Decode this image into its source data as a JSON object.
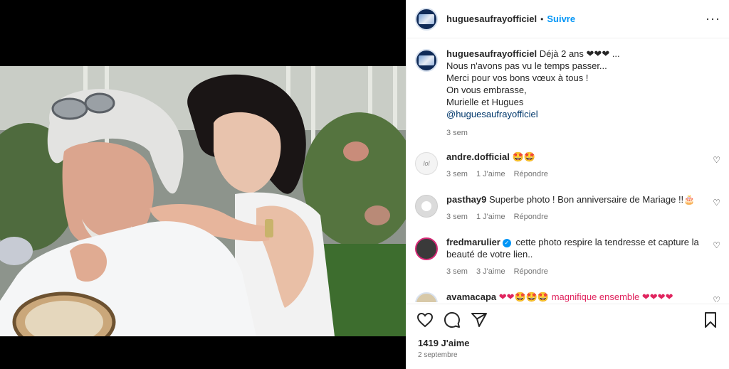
{
  "post": {
    "username": "huguesaufrayofficiel",
    "follow_label": "Suivre",
    "more_label": "···"
  },
  "caption": {
    "username": "huguesaufrayofficiel",
    "line1": "Déjà 2 ans ❤❤❤ ...",
    "line2": "Nous n'avons pas vu le temps passer...",
    "line3": "Merci pour vos bons vœux à tous !",
    "line4": "On vous embrasse,",
    "line5": "Murielle et Hugues",
    "mention": "@huguesaufrayofficiel",
    "time": "3 sem"
  },
  "comments": [
    {
      "username": "andre.dofficial",
      "text": "🤩🤩",
      "time": "3 sem",
      "likes": "1 J'aime",
      "reply": "Répondre",
      "avatar_text": "lol"
    },
    {
      "username": "pasthay9",
      "text": "Superbe photo ! Bon anniversaire de Mariage !!🎂",
      "time": "3 sem",
      "likes": "1 J'aime",
      "reply": "Répondre"
    },
    {
      "username": "fredmarulier",
      "verified": "✓",
      "text": "cette photo respire la tendresse et capture la beauté de votre lien..",
      "time": "3 sem",
      "likes": "3 J'aime",
      "reply": "Répondre"
    },
    {
      "username": "avamacapa",
      "text": "❤❤🤩🤩🤩 magnifique ensemble ❤❤❤❤"
    }
  ],
  "footer": {
    "likes": "1419 J'aime",
    "date": "2 septembre"
  },
  "icons": {
    "heart": "heart-icon",
    "comment": "comment-icon",
    "share": "share-icon",
    "save": "bookmark-icon",
    "more": "more-icon"
  },
  "colors": {
    "accent": "#0095f6",
    "text": "#262626",
    "muted": "#737373",
    "heart_red": "#e0245e"
  }
}
